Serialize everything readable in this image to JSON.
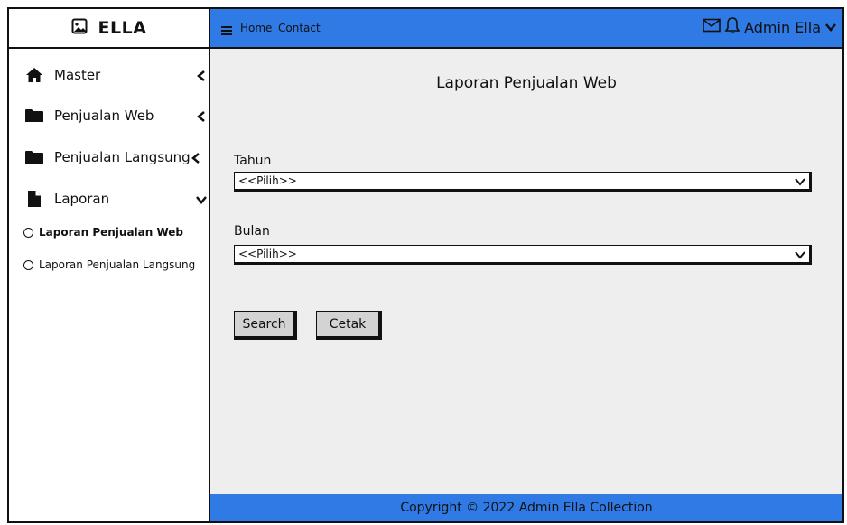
{
  "brand": {
    "name": "ELLA",
    "icon": "image-icon"
  },
  "topbar": {
    "nav": [
      "Home",
      "Contact"
    ],
    "user": "Admin Ella",
    "icons": [
      "menu-icon",
      "mail-icon",
      "bell-icon",
      "chevron-down-icon"
    ],
    "color": "#2f7ae5"
  },
  "sidebar": {
    "items": [
      {
        "label": "Master",
        "icon": "home-icon"
      },
      {
        "label": "Penjualan Web",
        "icon": "folder-icon"
      },
      {
        "label": "Penjualan Langsung",
        "icon": "folder-icon"
      },
      {
        "label": "Laporan",
        "icon": "file-icon"
      }
    ],
    "subitems": [
      {
        "label": "Laporan Penjualan Web",
        "active": true
      },
      {
        "label": "Laporan Penjualan Langsung",
        "active": false
      }
    ]
  },
  "main": {
    "title": "Laporan Penjualan Web",
    "tahun_label": "Tahun",
    "tahun_value": "<<Pilih>>",
    "bulan_label": "Bulan",
    "bulan_value": "<<Pilih>>",
    "search_label": "Search",
    "cetak_label": "Cetak"
  },
  "footer": {
    "text": "Copyright © 2022 Admin Ella Collection"
  }
}
